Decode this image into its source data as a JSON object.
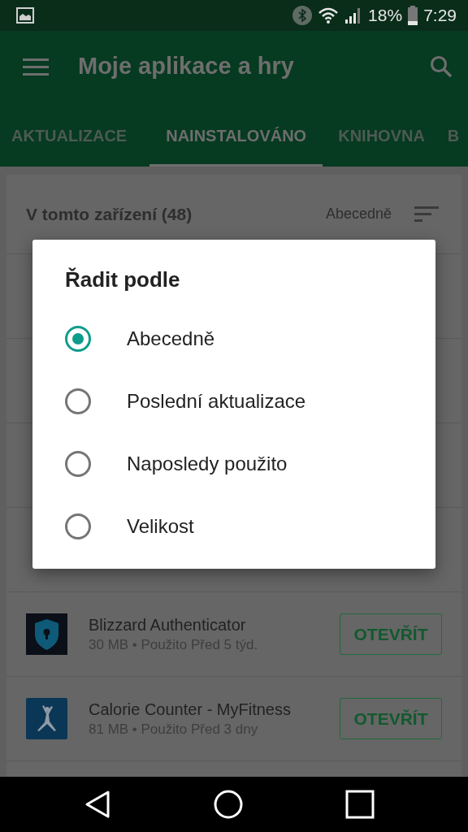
{
  "status_bar": {
    "battery": "18%",
    "time": "7:29"
  },
  "app_bar": {
    "title": "Moje aplikace a hry"
  },
  "tabs": [
    {
      "label": "AKTUALIZACE",
      "selected": false
    },
    {
      "label": "NAINSTALOVÁNO",
      "selected": true
    },
    {
      "label": "KNIHOVNA",
      "selected": false
    },
    {
      "label": "B",
      "selected": false
    }
  ],
  "list": {
    "header": "V tomto zařízení (48)",
    "sort_label": "Abecedně"
  },
  "apps": [
    {
      "name": "Blizzard Authenticator",
      "meta": "30 MB • Použito Před 5 týd.",
      "button": "OTEVŘÍT",
      "kind": "shield"
    },
    {
      "name": "Calorie Counter - MyFitness",
      "meta": "81 MB • Použito Před 3 dny",
      "button": "OTEVŘÍT",
      "kind": "figure"
    }
  ],
  "dialog": {
    "title": "Řadit podle",
    "options": [
      {
        "label": "Abecedně",
        "selected": true
      },
      {
        "label": "Poslední aktualizace",
        "selected": false
      },
      {
        "label": "Naposledy použito",
        "selected": false
      },
      {
        "label": "Velikost",
        "selected": false
      }
    ]
  }
}
